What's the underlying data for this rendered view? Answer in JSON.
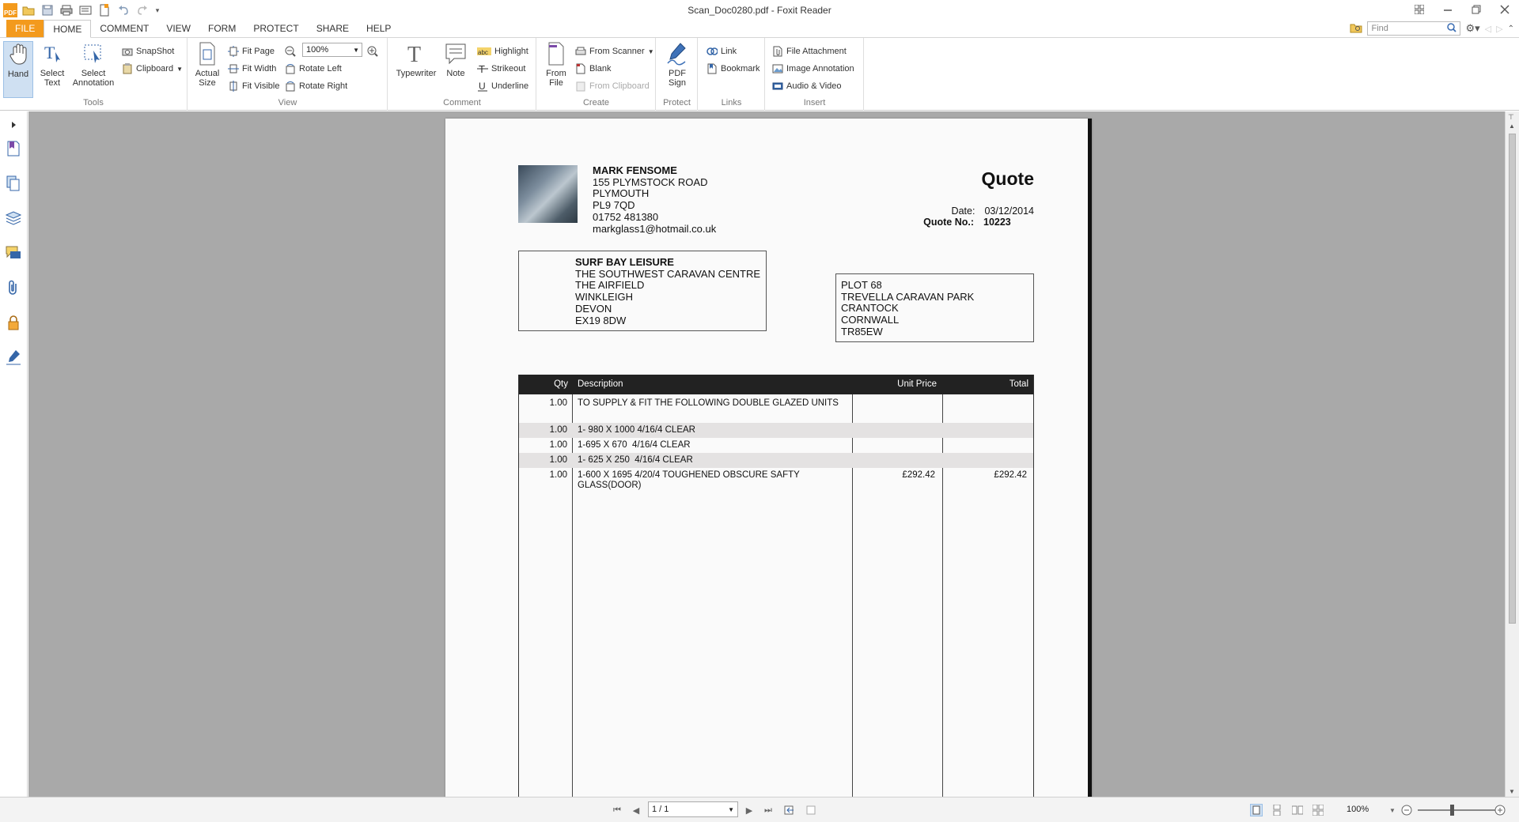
{
  "app": {
    "window_title": "Scan_Doc0280.pdf - Foxit Reader",
    "logo_text": "PDF"
  },
  "tabs": [
    "FILE",
    "HOME",
    "COMMENT",
    "VIEW",
    "FORM",
    "PROTECT",
    "SHARE",
    "HELP"
  ],
  "find": {
    "placeholder": "Find"
  },
  "ribbon": {
    "tools": {
      "label": "Tools",
      "hand": "Hand",
      "select_text": "Select Text",
      "select_annotation": "Select Annotation",
      "snapshot": "SnapShot",
      "clipboard": "Clipboard"
    },
    "view": {
      "label": "View",
      "actual_size": "Actual Size",
      "fit_page": "Fit Page",
      "fit_width": "Fit Width",
      "fit_visible": "Fit Visible",
      "zoom_value": "100%",
      "rotate_left": "Rotate Left",
      "rotate_right": "Rotate Right"
    },
    "comment": {
      "label": "Comment",
      "typewriter": "Typewriter",
      "note": "Note",
      "highlight": "Highlight",
      "strikeout": "Strikeout",
      "underline": "Underline"
    },
    "create": {
      "label": "Create",
      "from_file": "From File",
      "from_scanner": "From Scanner",
      "blank": "Blank",
      "from_clipboard": "From Clipboard"
    },
    "protect": {
      "label": "Protect",
      "pdf_sign": "PDF Sign"
    },
    "links": {
      "label": "Links",
      "link": "Link",
      "bookmark": "Bookmark"
    },
    "insert": {
      "label": "Insert",
      "file_attachment": "File Attachment",
      "image_annotation": "Image Annotation",
      "audio_video": "Audio & Video"
    }
  },
  "document": {
    "sender": {
      "name": "MARK FENSOME",
      "street": "155 PLYMSTOCK ROAD",
      "city": "PLYMOUTH",
      "postcode": "PL9 7QD",
      "phone": "01752 481380",
      "email": "markglass1@hotmail.co.uk"
    },
    "title": "Quote",
    "date_label": "Date:",
    "date_value": "03/12/2014",
    "quote_no_label": "Quote No.:",
    "quote_no_value": "10223",
    "bill_to": [
      "SURF BAY LEISURE",
      "THE SOUTHWEST CARAVAN CENTRE",
      "THE AIRFIELD",
      "WINKLEIGH",
      "DEVON",
      "EX19 8DW"
    ],
    "ship_to": [
      "PLOT 68",
      "TREVELLA CARAVAN PARK",
      "CRANTOCK",
      "CORNWALL",
      "TR85EW"
    ],
    "table": {
      "headers": {
        "qty": "Qty",
        "description": "Description",
        "unit_price": "Unit Price",
        "total": "Total"
      },
      "rows": [
        {
          "qty": "1.00",
          "description": "TO SUPPLY & FIT THE FOLLOWING DOUBLE GLAZED UNITS",
          "unit_price": "",
          "total": ""
        },
        {
          "qty": "1.00",
          "description": "1- 980 X 1000 4/16/4 CLEAR",
          "unit_price": "",
          "total": ""
        },
        {
          "qty": "1.00",
          "description": "1-695 X 670  4/16/4 CLEAR",
          "unit_price": "",
          "total": ""
        },
        {
          "qty": "1.00",
          "description": "1- 625 X 250  4/16/4 CLEAR",
          "unit_price": "",
          "total": ""
        },
        {
          "qty": "1.00",
          "description": "1-600 X 1695 4/20/4 TOUGHENED OBSCURE SAFTY GLASS(DOOR)",
          "unit_price": "£292.42",
          "total": "£292.42"
        }
      ]
    }
  },
  "statusbar": {
    "page_indicator": "1 / 1",
    "zoom": "100%"
  }
}
